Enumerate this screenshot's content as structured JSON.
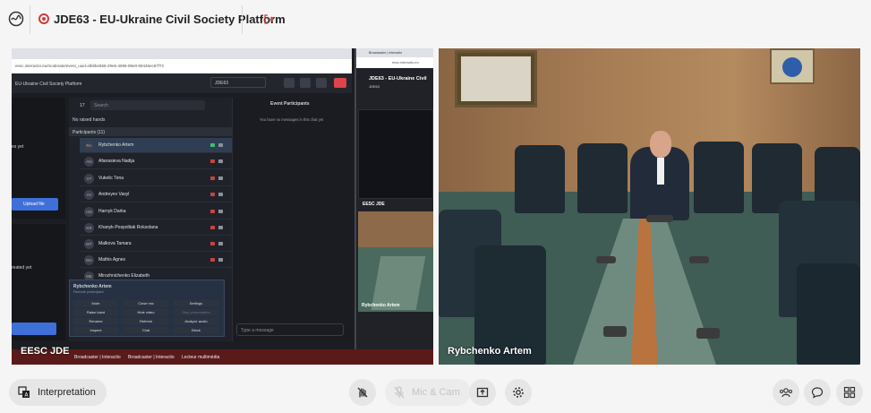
{
  "header": {
    "title": "JDE63 - EU-Ukraine Civil Society Platform"
  },
  "tiles": [
    {
      "name": "EESC JDE",
      "screen": {
        "url": "eesc.interactio.eu/moderate/event_uuid=8b9be558-29e6-4695-99e0-69445ec87f72",
        "app_title": "EU-Ukraine Civil Society Platform",
        "room": "JDE63",
        "search_placeholder": "Search",
        "search_count": "17",
        "raised_hands": "No raised hands",
        "participants_header": "Participants (11)",
        "participants": [
          {
            "initials": "RA",
            "name": "Rybchenko Artem"
          },
          {
            "initials": "AN",
            "name": "Afanasieva Nadija"
          },
          {
            "initials": "VT",
            "name": "Vukelic Tena"
          },
          {
            "initials": "AV",
            "name": "Andreyev Vasyl"
          },
          {
            "initials": "HD",
            "name": "Harnyk Darka"
          },
          {
            "initials": "KR",
            "name": "Khanyk-Pospolitak Roksolana"
          },
          {
            "initials": "MT",
            "name": "Malkova Tamara"
          },
          {
            "initials": "MA",
            "name": "Mathis Agnes"
          },
          {
            "initials": "ME",
            "name": "Mirozhnichenko Elizabeth"
          }
        ],
        "event_participants": "Event Participants",
        "no_messages": "You have no messages in this chat yet",
        "type_message": "Type a message",
        "upload_file": "Upload file",
        "left_text_1": "es yet",
        "left_text_2": "reated yet",
        "popup_name": "Rybchenko Artem",
        "popup_sub": "Remote participant",
        "popup_buttons": [
          "Mute",
          "Close mic",
          "Settings",
          "Raise hand",
          "Hide video",
          "Stop presentation",
          "Rename",
          "Refresh",
          "Analyze audio",
          "Inspect",
          "Chat",
          "Block"
        ],
        "taskbar": [
          "Broadcaster | Interactio",
          "Broadcaster | Interactio",
          "Lecteur multimédia"
        ],
        "mini_title": "JDE63 - EU-Ukraine Civil",
        "mini_url": "eesc.interactio.eu",
        "mini_tab": "Broadcaster | Interactio",
        "mini_label_1": "EESC JDE",
        "mini_label_2": "Rybchenko Artem"
      }
    },
    {
      "name": "Rybchenko Artem"
    }
  ],
  "controls": {
    "interpretation": "Interpretation",
    "mic_cam": "Mic & Cam"
  },
  "colors": {
    "record": "#d23a3a",
    "leave": "#d23a3a",
    "bar_bg": "#f5f5f5",
    "button_bg": "#e6e6e6"
  },
  "icons": [
    "app-logo-icon",
    "record-icon",
    "leave-icon",
    "translate-icon",
    "hand-off-icon",
    "mic-off-icon",
    "share-screen-icon",
    "settings-icon",
    "participants-icon",
    "chat-icon",
    "apps-icon"
  ]
}
